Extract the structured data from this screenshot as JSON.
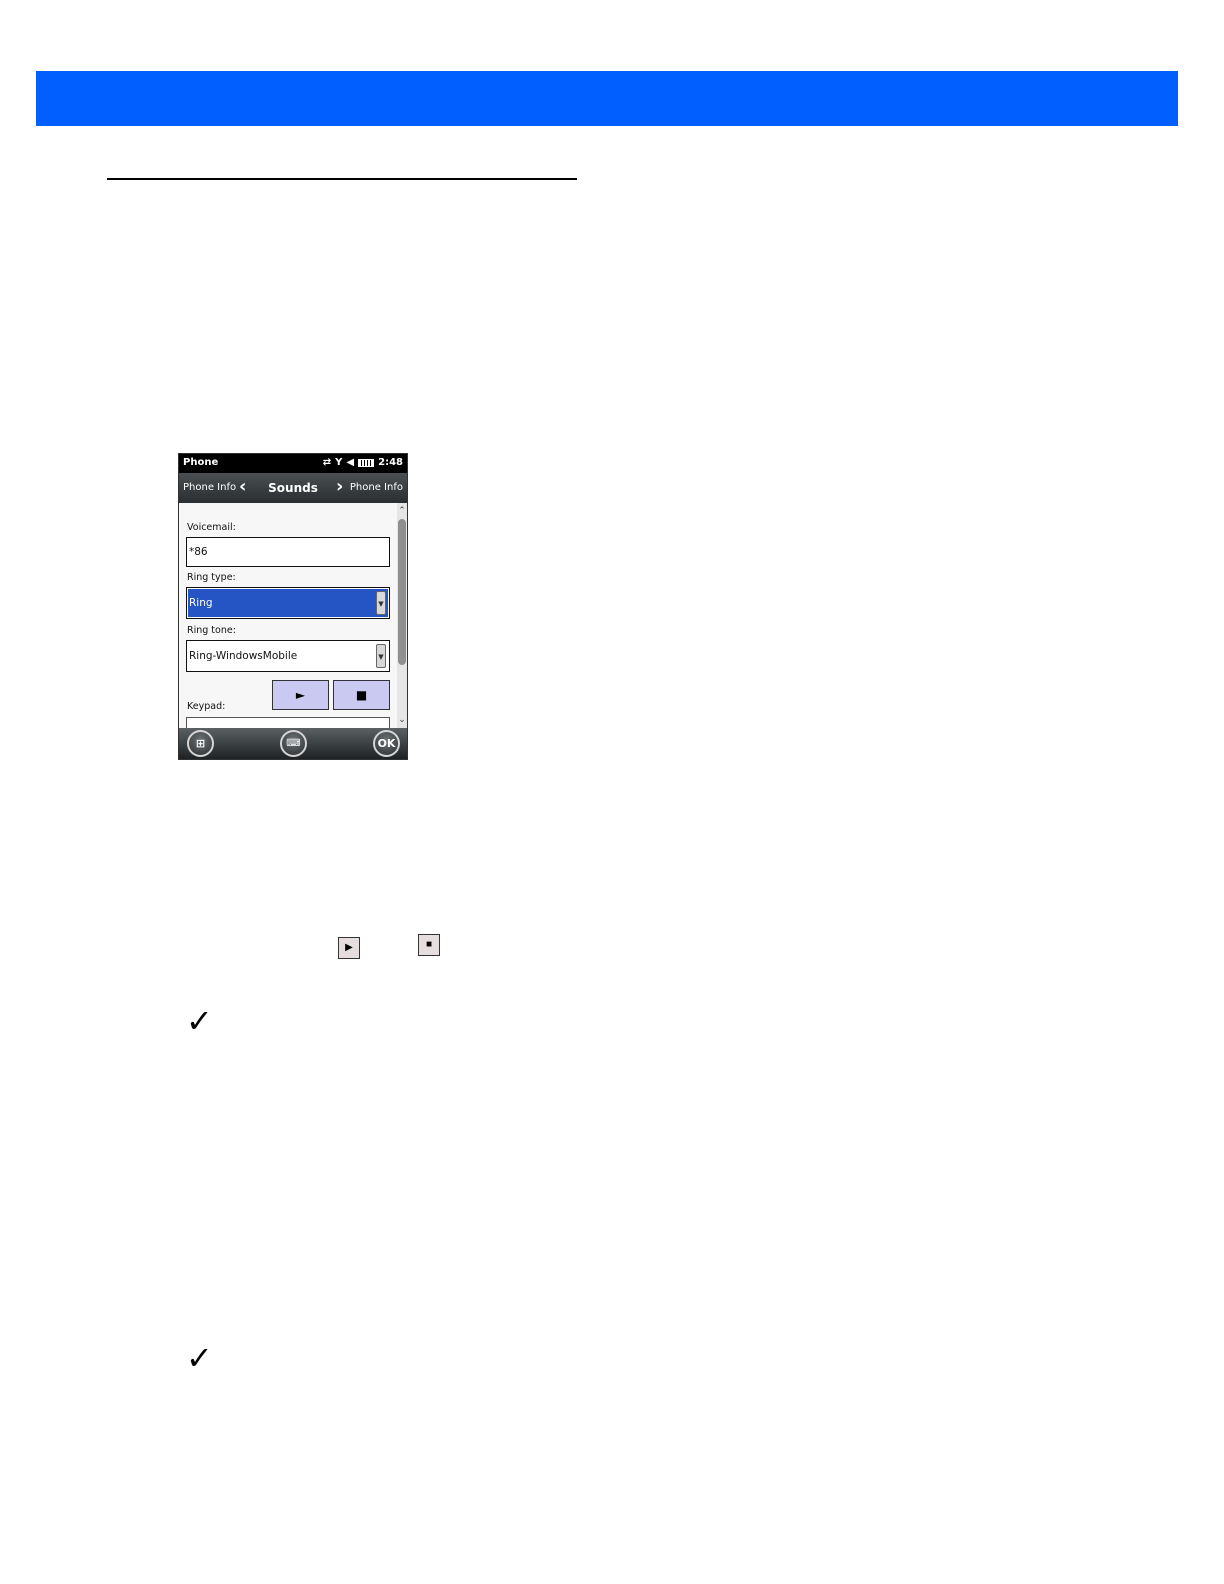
{
  "colors": {
    "header_bar": "#005ffe",
    "selection": "#2555c4",
    "media_button": "#c9c9f1"
  },
  "phone": {
    "status": {
      "title": "Phone",
      "time": "2:48",
      "icons": [
        "sync-icon",
        "signal-icon",
        "speaker-muted-icon",
        "battery-icon"
      ]
    },
    "nav": {
      "prev": "Phone Info",
      "current": "Sounds",
      "next": "Phone Info"
    },
    "fields": {
      "voicemail_label": "Voicemail:",
      "voicemail_value": "*86",
      "ring_type_label": "Ring type:",
      "ring_type_value": "Ring",
      "ring_tone_label": "Ring tone:",
      "ring_tone_value": "Ring-WindowsMobile",
      "keypad_label": "Keypad:"
    },
    "media": {
      "play": "►",
      "stop": "■"
    },
    "softkeys": {
      "ok": "OK"
    }
  },
  "inline_icons": {
    "play": "▶",
    "stop": "■"
  },
  "notes": {
    "check_glyph": "✓"
  }
}
